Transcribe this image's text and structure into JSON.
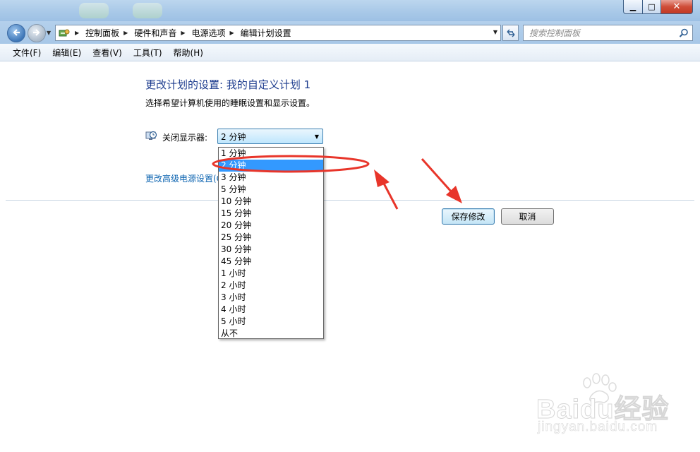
{
  "window": {
    "min_symbol": "▁",
    "max_symbol": "□",
    "close_symbol": "✕"
  },
  "nav": {
    "breadcrumbs": [
      "控制面板",
      "硬件和声音",
      "电源选项",
      "编辑计划设置"
    ],
    "search_placeholder": "搜索控制面板"
  },
  "menu": [
    "文件(F)",
    "编辑(E)",
    "查看(V)",
    "工具(T)",
    "帮助(H)"
  ],
  "main": {
    "title": "更改计划的设置: 我的自定义计划 1",
    "description": "选择希望计算机使用的睡眠设置和显示设置。",
    "display_off_label": "关闭显示器:",
    "display_off_value": "2 分钟",
    "advanced_link": "更改高级电源设置(C)",
    "save_button": "保存修改",
    "cancel_button": "取消"
  },
  "dropdown": {
    "options": [
      "1 分钟",
      "2 分钟",
      "3 分钟",
      "5 分钟",
      "10 分钟",
      "15 分钟",
      "20 分钟",
      "25 分钟",
      "30 分钟",
      "45 分钟",
      "1 小时",
      "2 小时",
      "3 小时",
      "4 小时",
      "5 小时",
      "从不"
    ],
    "highlighted": "2 分钟"
  },
  "watermark": {
    "brand": "Baidu经验",
    "url": "jingyan.baidu.com"
  },
  "colors": {
    "accent": "#1e3d8f",
    "link": "#0b63b0",
    "selection": "#3399ff",
    "annotation": "#e8352a"
  }
}
